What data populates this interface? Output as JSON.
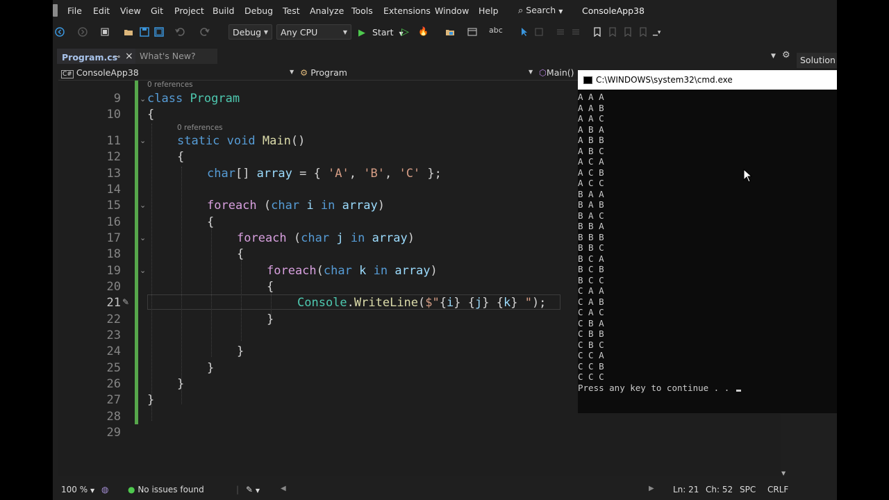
{
  "menu": [
    "File",
    "Edit",
    "View",
    "Git",
    "Project",
    "Build",
    "Debug",
    "Test",
    "Analyze",
    "Tools",
    "Extensions",
    "Window",
    "Help"
  ],
  "search_label": "Search",
  "app_title": "ConsoleApp38",
  "toolbar": {
    "config": "Debug",
    "platform": "Any CPU",
    "start": "Start"
  },
  "tabs": {
    "active": "Program.cs",
    "second": "What's New?"
  },
  "navbar": {
    "project": "ConsoleApp38",
    "class": "Program",
    "member": "Main()"
  },
  "solution_explorer": "Solution Explorer",
  "editor": {
    "refs_class": "0 references",
    "refs_method": "0 references",
    "line_numbers": [
      "9",
      "10",
      "11",
      "12",
      "13",
      "14",
      "15",
      "16",
      "17",
      "18",
      "19",
      "20",
      "21",
      "22",
      "23",
      "24",
      "25",
      "26",
      "27",
      "28",
      "29"
    ],
    "code": {
      "l9_kw": "class",
      "l9_name": "Program",
      "brace_open": "{",
      "brace_close": "}",
      "l11_kw1": "static",
      "l11_kw2": "void",
      "l11_name": "Main",
      "l11_parens": "()",
      "l13_type": "char",
      "l13_rest1": "[] ",
      "l13_var": "array",
      "l13_eq": " = { ",
      "l13_a": "'A'",
      "l13_comma": ", ",
      "l13_b": "'B'",
      "l13_c": "'C'",
      "l13_end": " };",
      "foreach": "foreach",
      "char": "char",
      "in": "in",
      "l15_var": "i",
      "l17_var": "j",
      "l19_var": "k",
      "array": "array",
      "l21_class": "Console",
      "l21_dot": ".",
      "l21_method": "WriteLine",
      "l21_open": "(",
      "l21_str1": "$\"",
      "l21_i": "i",
      "l21_j": "j",
      "l21_k": "k",
      "l21_str2": " \"",
      "l21_end": ");"
    }
  },
  "console": {
    "title": "C:\\WINDOWS\\system32\\cmd.exe",
    "lines": [
      "A A A",
      "A A B",
      "A A C",
      "A B A",
      "A B B",
      "A B C",
      "A C A",
      "A C B",
      "A C C",
      "B A A",
      "B A B",
      "B A C",
      "B B A",
      "B B B",
      "B B C",
      "B C A",
      "B C B",
      "B C C",
      "C A A",
      "C A B",
      "C A C",
      "C B A",
      "C B B",
      "C B C",
      "C C A",
      "C C B",
      "C C C"
    ],
    "prompt": "Press any key to continue . . ."
  },
  "status": {
    "zoom": "100 %",
    "issues": "No issues found",
    "line": "Ln: 21",
    "col": "Ch: 52",
    "spc": "SPC",
    "eol": "CRLF"
  }
}
